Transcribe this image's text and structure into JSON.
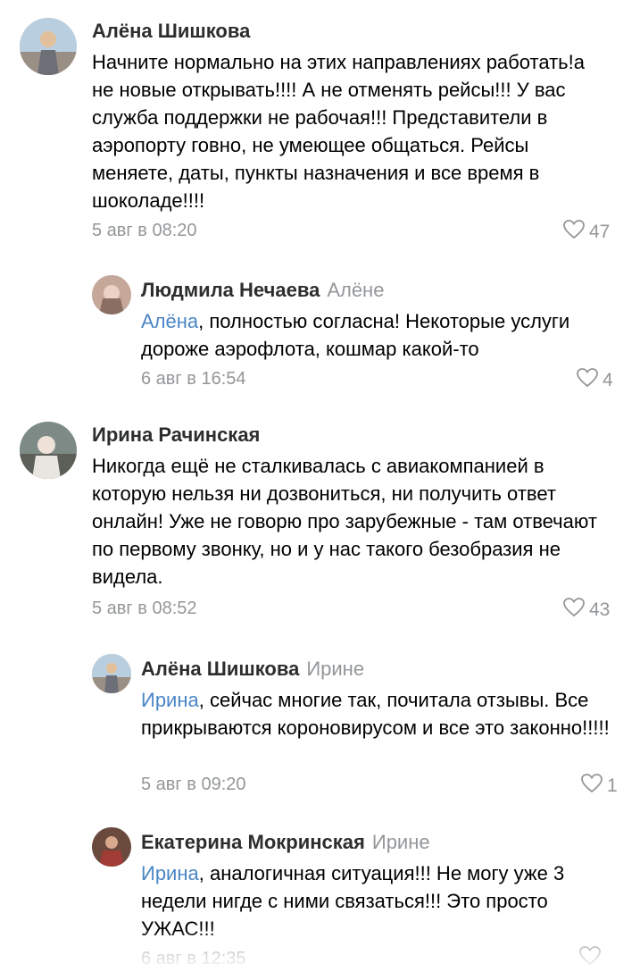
{
  "comments": [
    {
      "author": "Алёна Шишкова",
      "text": "Начните нормально на этих направлениях работать!а не новые открывать!!!! А не отменять рейсы!!! У вас служба поддержки не рабочая!!! Представители в аэропорту говно, не умеющее общаться. Рейсы меняете, даты, пункты назначения и все время в шоколаде!!!!",
      "date": "5 авг в 08:20",
      "likes": "47"
    },
    {
      "author": "Людмила Нечаева",
      "reply_to": "Алёне",
      "mention": "Алёна",
      "text": ", полностью согласна! Некоторые услуги дороже аэрофлота, кошмар какой-то",
      "date": "6 авг в 16:54",
      "likes": "4"
    },
    {
      "author": "Ирина Рачинская",
      "text": "Никогда ещё не сталкивалась с авиакомпанией в которую нельзя ни дозвониться, ни получить ответ онлайн! Уже не говорю про зарубежные - там отвечают по первому звонку, но и у нас такого безобразия не видела.",
      "date": "5 авг в 08:52",
      "likes": "43"
    },
    {
      "author": "Алёна Шишкова",
      "reply_to": "Ирине",
      "mention": "Ирина",
      "text": ", сейчас многие так, почитала отзывы. Все прикрываются короновирусом и все это законно!!!!!",
      "date": "5 авг в 09:20",
      "likes": "1"
    },
    {
      "author": "Екатерина Мокринская",
      "reply_to": "Ирине",
      "mention": "Ирина",
      "text": ", аналогичная ситуация!!! Не могу уже 3 недели нигде с ними связаться!!! Это просто УЖАС!!!",
      "date": "6 авг в 12:35",
      "likes": ""
    }
  ],
  "icons": {
    "like": "heart-outline-icon"
  },
  "colors": {
    "mention": "#4a86c6",
    "meta": "#939699",
    "name": "#2c2d2e"
  }
}
